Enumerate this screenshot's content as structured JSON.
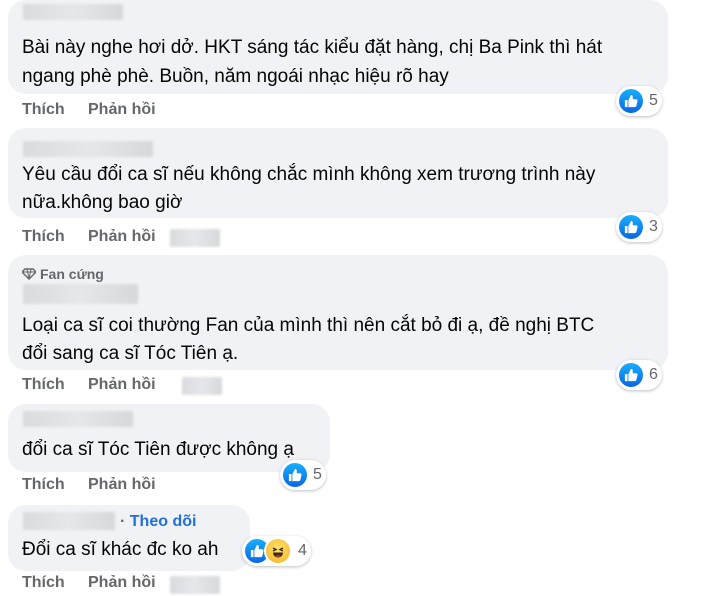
{
  "actions": {
    "like_label": "Thích",
    "reply_label": "Phản hồi"
  },
  "comments": [
    {
      "text_lines": [
        "Bài này nghe hơi dở. HKT sáng tác kiểu đặt hàng, chị Ba Pink thì hát",
        "ngang phè phè. Buồn, năm ngoái nhạc hiệu rõ hay"
      ],
      "reaction_count": "5"
    },
    {
      "text_lines": [
        "Yêu cầu đổi ca sĩ nếu không chắc mình không xem trương trình này",
        "nữa.không bao giờ"
      ],
      "reaction_count": "3"
    },
    {
      "badge": "Fan cứng",
      "text_lines": [
        "Loại ca sĩ coi thường Fan của mình thì nên cắt bỏ đi ạ, đề nghị BTC",
        "đổi sang ca sĩ Tóc Tiên ạ."
      ],
      "reaction_count": "6"
    },
    {
      "text_lines": [
        "đổi ca sĩ Tóc Tiên được không ạ"
      ],
      "reaction_count": "5"
    },
    {
      "follow_label": "Theo dõi",
      "text_lines": [
        "Đổi ca sĩ khác đc ko ah"
      ],
      "reaction_count": "4"
    }
  ],
  "icons": {
    "reaction_like": "like-icon",
    "reaction_haha": "haha-icon",
    "badge": "diamond-icon"
  },
  "colors": {
    "bubble": "#f0f2f5",
    "link": "#216fdb",
    "muted": "#65676b",
    "like": "#0a66e2"
  }
}
